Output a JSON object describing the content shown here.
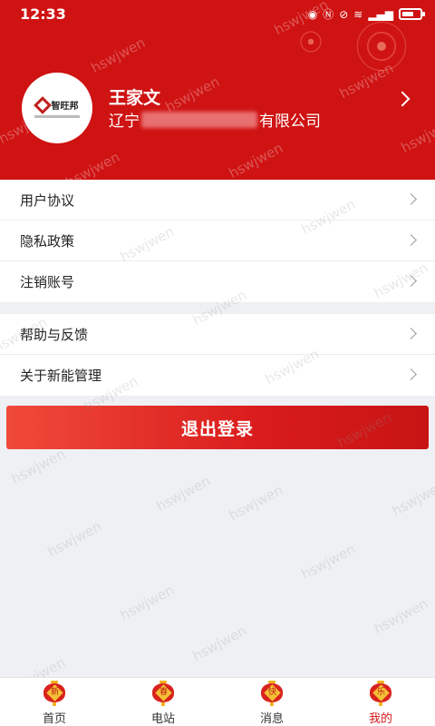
{
  "status_bar": {
    "time": "12:33",
    "icons": [
      "eye-icon",
      "nfc-icon",
      "mute-icon",
      "wifi-icon",
      "signal-icon",
      "battery-icon"
    ]
  },
  "profile": {
    "logo_text": "智旺邦",
    "name": "王家文",
    "company_prefix": "辽宁",
    "company_suffix": "有限公司"
  },
  "menu_group_1": [
    {
      "label": "用户协议"
    },
    {
      "label": "隐私政策"
    },
    {
      "label": "注销账号"
    }
  ],
  "menu_group_2": [
    {
      "label": "帮助与反馈"
    },
    {
      "label": "关于新能管理"
    }
  ],
  "logout_label": "退出登录",
  "watermark_text": "hswjwen",
  "tabs": [
    {
      "label": "首页",
      "badge": "新",
      "active": false
    },
    {
      "label": "电站",
      "badge": "春",
      "active": false
    },
    {
      "label": "消息",
      "badge": "快",
      "active": false
    },
    {
      "label": "我的",
      "badge": "乐",
      "active": true
    }
  ],
  "colors": {
    "brand_red": "#cf1212",
    "accent_active": "#d41b1b",
    "background": "#eef0f4"
  }
}
